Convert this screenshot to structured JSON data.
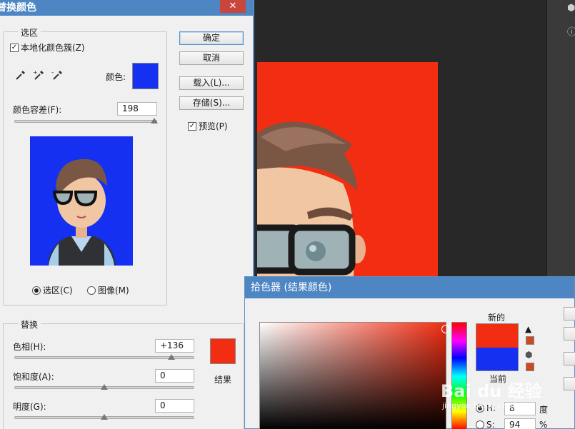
{
  "replace_color": {
    "title": "替换颜色",
    "close_icon": "close-icon",
    "selection_group": "选区",
    "localized_clusters_label": "本地化颜色簇(Z)",
    "localized_clusters_checked": true,
    "eyedropper_icons": [
      "eyedropper-icon",
      "eyedropper-add-icon",
      "eyedropper-subtract-icon"
    ],
    "color_label": "颜色:",
    "selection_color": "#1530f0",
    "fuzziness_label": "颜色容差(F):",
    "fuzziness_value": "198",
    "fuzziness_max": 200,
    "view_selection_label": "选区(C)",
    "view_image_label": "图像(M)",
    "view_selection_selected": true,
    "preview_bg": "#1530f0",
    "replacement_group": "替换",
    "hue_label": "色相(H):",
    "hue_value": "+136",
    "saturation_label": "饱和度(A):",
    "saturation_value": "0",
    "lightness_label": "明度(G):",
    "lightness_value": "0",
    "result_label": "结果",
    "result_color": "#f22d12",
    "buttons": {
      "ok": "确定",
      "cancel": "取消",
      "load": "载入(L)...",
      "save": "存储(S)..."
    },
    "preview_label": "预览(P)",
    "preview_checked": true
  },
  "picker": {
    "title": "拾色器 (结果颜色)",
    "new_label": "新的",
    "current_label": "当前",
    "new_color": "#f22d12",
    "current_color": "#1530f0",
    "gamut_warning_icon": "warning-icon",
    "web_safe_icon": "cube-icon",
    "h_label": "H:",
    "h_value": "8",
    "h_unit": "度",
    "s_label": "S:",
    "s_value": "94",
    "s_unit": "%"
  },
  "workspace": {
    "canvas_color": "#f22d12"
  },
  "watermark": {
    "text": "Bai du 经验",
    "sub": "jingyan.baidu.com"
  }
}
